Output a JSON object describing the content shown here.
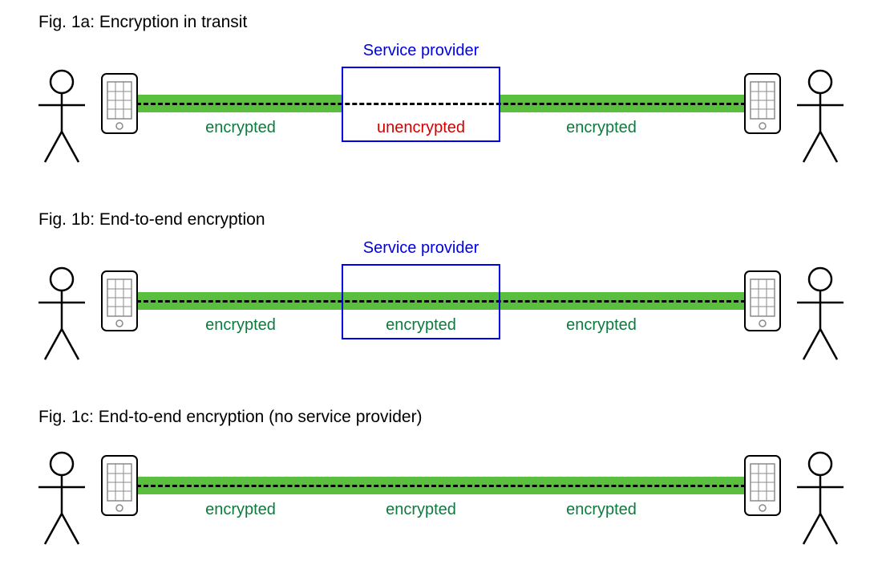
{
  "figures": {
    "a": {
      "caption": "Fig. 1a: Encryption in transit",
      "provider_label": "Service provider",
      "seg_left": "encrypted",
      "seg_mid": "unencrypted",
      "seg_right": "encrypted"
    },
    "b": {
      "caption": "Fig. 1b: End-to-end encryption",
      "provider_label": "Service provider",
      "seg_left": "encrypted",
      "seg_mid": "encrypted",
      "seg_right": "encrypted"
    },
    "c": {
      "caption": "Fig. 1c: End-to-end encryption (no service provider)",
      "seg_left": "encrypted",
      "seg_mid": "encrypted",
      "seg_right": "encrypted"
    }
  }
}
